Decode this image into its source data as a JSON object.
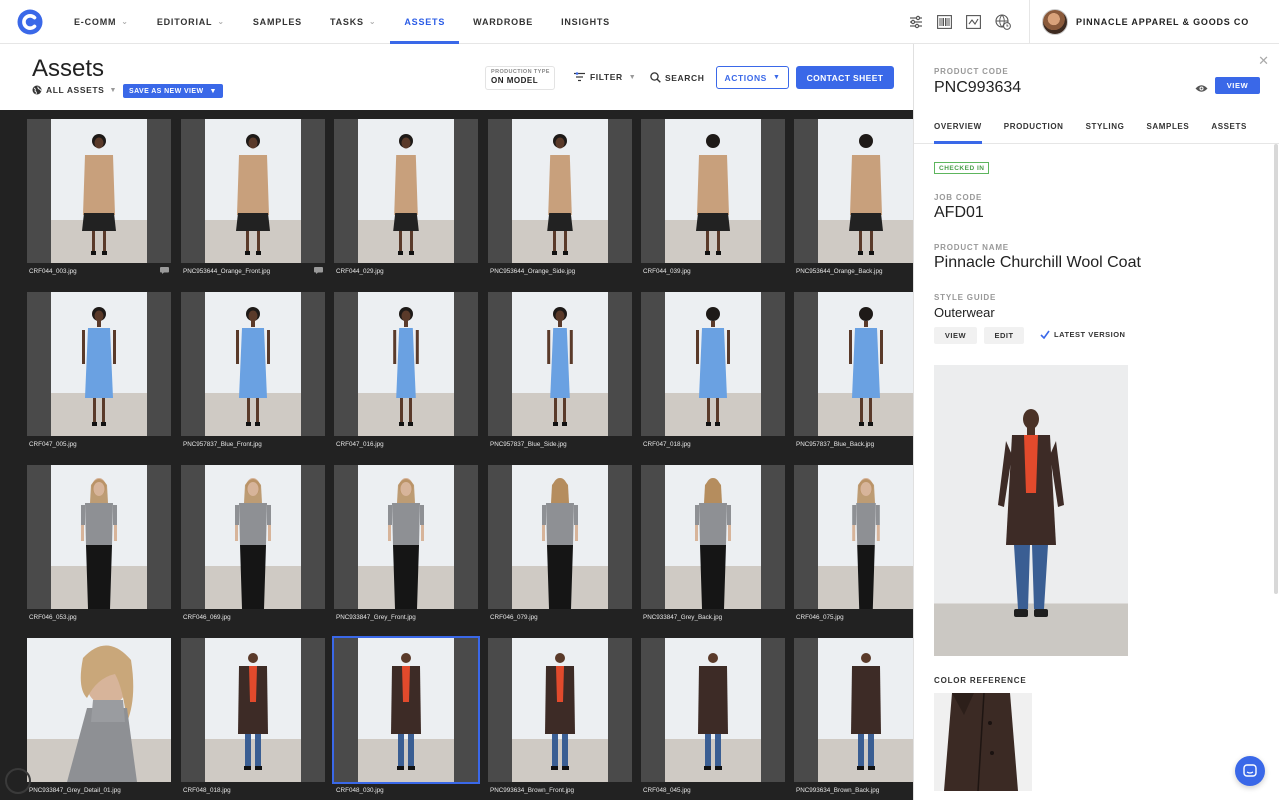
{
  "nav": {
    "logo": "C",
    "items": [
      {
        "label": "E-COMM",
        "dropdown": true
      },
      {
        "label": "EDITORIAL",
        "dropdown": true
      },
      {
        "label": "SAMPLES",
        "dropdown": false
      },
      {
        "label": "TASKS",
        "dropdown": true
      },
      {
        "label": "ASSETS",
        "dropdown": false,
        "active": true
      },
      {
        "label": "WARDROBE",
        "dropdown": false
      },
      {
        "label": "INSIGHTS",
        "dropdown": false
      }
    ],
    "tool_icons": [
      "sliders-icon",
      "barcode-icon",
      "chart-icon",
      "globe-clock-icon"
    ],
    "account_name": "PINNACLE APPAREL & GOODS CO"
  },
  "header": {
    "title": "Assets",
    "view_select": "ALL ASSETS",
    "save_view": "SAVE AS NEW VIEW",
    "production_type_label": "PRODUCTION TYPE",
    "production_type_value": "ON MODEL",
    "filter": "FILTER",
    "search": "SEARCH",
    "actions": "ACTIONS",
    "contact_sheet": "CONTACT SHEET"
  },
  "assets": [
    {
      "name": "CRF044_003.jpg",
      "subject": "tan-coat",
      "pose": "front",
      "comment": true
    },
    {
      "name": "PNC953644_Orange_Front.jpg",
      "subject": "tan-coat",
      "pose": "front",
      "comment": true
    },
    {
      "name": "CRF044_029.jpg",
      "subject": "tan-coat",
      "pose": "side",
      "comment": false
    },
    {
      "name": "PNC953644_Orange_Side.jpg",
      "subject": "tan-coat",
      "pose": "side",
      "comment": false
    },
    {
      "name": "CRF044_039.jpg",
      "subject": "tan-coat",
      "pose": "back",
      "comment": false
    },
    {
      "name": "PNC953644_Orange_Back.jpg",
      "subject": "tan-coat",
      "pose": "back",
      "comment": false
    },
    {
      "name": "CRF047_005.jpg",
      "subject": "blue-dress",
      "pose": "front",
      "comment": false
    },
    {
      "name": "PNC957837_Blue_Front.jpg",
      "subject": "blue-dress",
      "pose": "front",
      "comment": false
    },
    {
      "name": "CRF047_016.jpg",
      "subject": "blue-dress",
      "pose": "side",
      "comment": false
    },
    {
      "name": "PNC957837_Blue_Side.jpg",
      "subject": "blue-dress",
      "pose": "side",
      "comment": false
    },
    {
      "name": "CRF047_018.jpg",
      "subject": "blue-dress",
      "pose": "back",
      "comment": false
    },
    {
      "name": "PNC957837_Blue_Back.jpg",
      "subject": "blue-dress",
      "pose": "back",
      "comment": false
    },
    {
      "name": "CRF046_053.jpg",
      "subject": "grey-top",
      "pose": "front",
      "comment": false
    },
    {
      "name": "CRF046_069.jpg",
      "subject": "grey-top",
      "pose": "front",
      "comment": false
    },
    {
      "name": "PNC933847_Grey_Front.jpg",
      "subject": "grey-top",
      "pose": "front",
      "comment": false
    },
    {
      "name": "CRF046_079.jpg",
      "subject": "grey-top",
      "pose": "back",
      "comment": false
    },
    {
      "name": "PNC933847_Grey_Back.jpg",
      "subject": "grey-top",
      "pose": "back",
      "comment": false
    },
    {
      "name": "CRF046_075.jpg",
      "subject": "grey-top",
      "pose": "side",
      "comment": false
    },
    {
      "name": "PNC933847_Grey_Detail_01.jpg",
      "subject": "grey-detail",
      "pose": "detail",
      "comment": false
    },
    {
      "name": "CRF048_018.jpg",
      "subject": "brown-coat",
      "pose": "front",
      "comment": false
    },
    {
      "name": "CRF048_030.jpg",
      "subject": "brown-coat",
      "pose": "front",
      "comment": false,
      "selected": true
    },
    {
      "name": "PNC993634_Brown_Front.jpg",
      "subject": "brown-coat",
      "pose": "front",
      "comment": false
    },
    {
      "name": "CRF048_045.jpg",
      "subject": "brown-coat",
      "pose": "back",
      "comment": false
    },
    {
      "name": "PNC993634_Brown_Back.jpg",
      "subject": "brown-coat",
      "pose": "back",
      "comment": false
    }
  ],
  "panel": {
    "product_code_label": "PRODUCT CODE",
    "product_code": "PNC993634",
    "view_button": "VIEW",
    "tabs": [
      {
        "label": "OVERVIEW",
        "active": true
      },
      {
        "label": "PRODUCTION",
        "active": false
      },
      {
        "label": "STYLING",
        "active": false
      },
      {
        "label": "SAMPLES",
        "active": false
      },
      {
        "label": "ASSETS",
        "active": false
      }
    ],
    "status": "CHECKED IN",
    "job_code_label": "JOB CODE",
    "job_code": "AFD01",
    "product_name_label": "PRODUCT NAME",
    "product_name": "Pinnacle Churchill Wool Coat",
    "style_guide_label": "STYLE GUIDE",
    "style_guide": "Outerwear",
    "style_view": "VIEW",
    "style_edit": "EDIT",
    "latest_version": "LATEST VERSION",
    "color_reference_label": "COLOR REFERENCE"
  },
  "colors": {
    "accent": "#3a68e8",
    "status_green": "#4a9e4a",
    "grid_bg": "#222222",
    "tan_coat": "#c8a07c",
    "blue_dress": "#6aa1e2",
    "grey_top": "#8e9094",
    "brown_coat": "#3d2b26",
    "orange_sweater": "#e24a2c"
  }
}
